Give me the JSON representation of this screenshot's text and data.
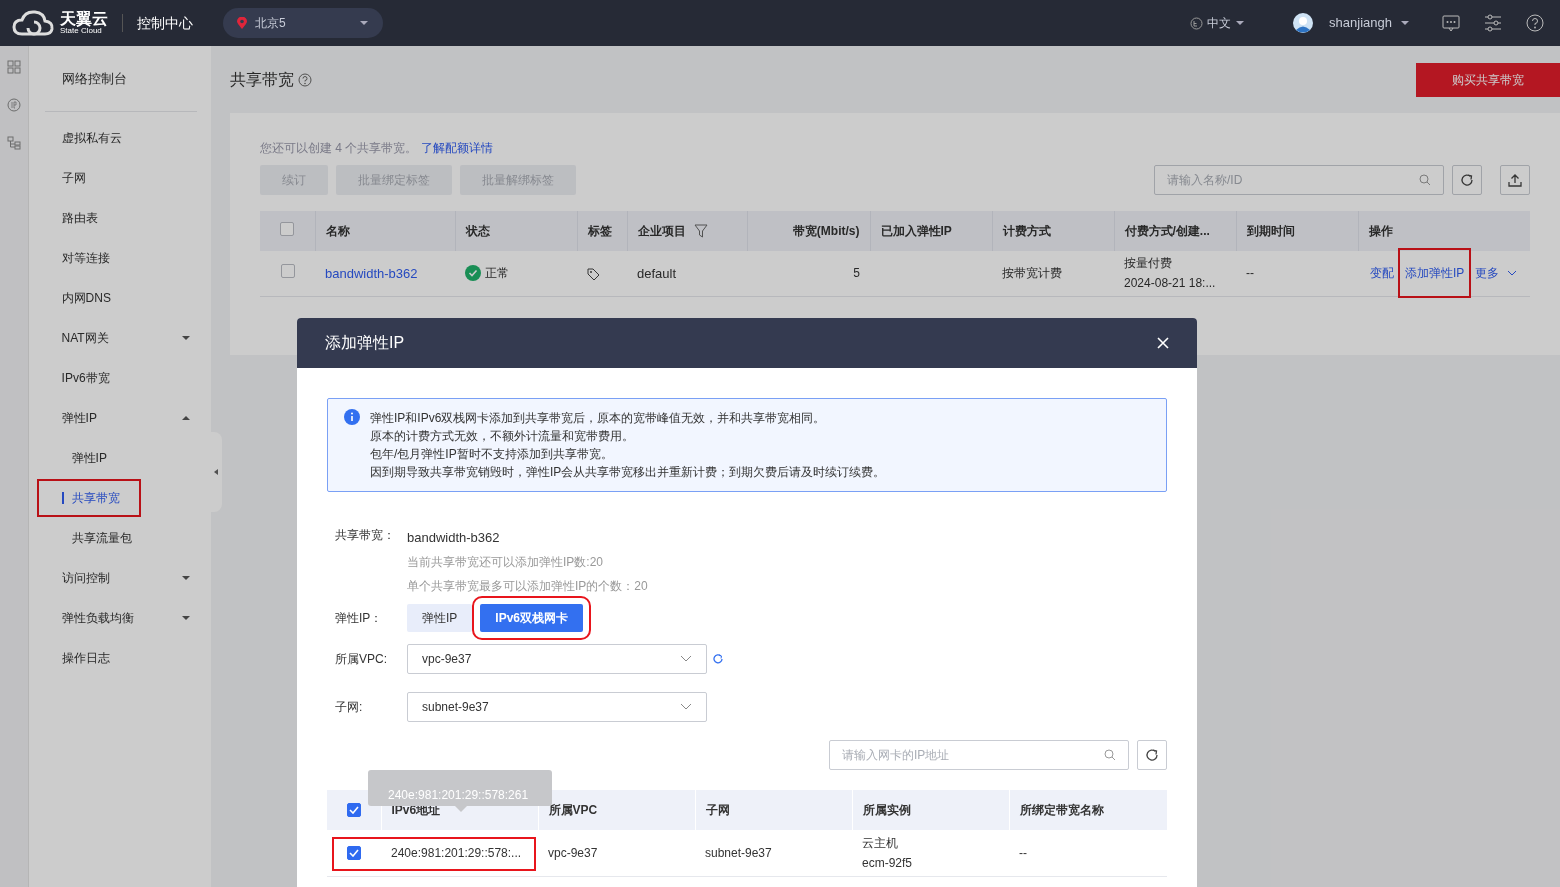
{
  "topbar": {
    "brand": "天翼云",
    "brand_sub": "State Cloud",
    "console": "控制中心",
    "region": "北京5",
    "language": "中文",
    "user": "shanjiangh"
  },
  "sidebar": {
    "title": "网络控制台",
    "items": [
      {
        "label": "虚拟私有云"
      },
      {
        "label": "子网"
      },
      {
        "label": "路由表"
      },
      {
        "label": "对等连接"
      },
      {
        "label": "内网DNS"
      },
      {
        "label": "NAT网关",
        "expanded": false
      },
      {
        "label": "IPv6带宽"
      },
      {
        "label": "弹性IP",
        "expanded": true,
        "children": [
          {
            "label": "弹性IP",
            "selected": false,
            "highlighted": false
          },
          {
            "label": "共享带宽",
            "selected": true,
            "highlighted": true
          },
          {
            "label": "共享流量包",
            "selected": false,
            "highlighted": false
          }
        ]
      },
      {
        "label": "访问控制",
        "expanded": false
      },
      {
        "label": "弹性负载均衡",
        "expanded": false
      },
      {
        "label": "操作日志"
      }
    ]
  },
  "page": {
    "title": "共享带宽",
    "buy_button": "购买共享带宽",
    "quota_text": "您还可以创建 4 个共享带宽。",
    "quota_link": "了解配额详情",
    "actions": [
      {
        "label": "续订",
        "disabled": true
      },
      {
        "label": "批量绑定标签",
        "disabled": true
      },
      {
        "label": "批量解绑标签",
        "disabled": true
      }
    ],
    "search": {
      "placeholder": "请输入名称/ID"
    },
    "table": {
      "all_checked": false,
      "columns": [
        "名称",
        "状态",
        "标签",
        "企业项目",
        "带宽(Mbit/s)",
        "已加入弹性IP",
        "计费方式",
        "付费方式/创建...",
        "到期时间",
        "操作"
      ],
      "rows": [
        {
          "checked": false,
          "name": "bandwidth-b362",
          "status": "正常",
          "project": "default",
          "bandwidth": "5",
          "billing": "按带宽计费",
          "payment": "按量付费",
          "created": "2024-08-21 18:...",
          "expiry": "--",
          "actions": [
            {
              "label": "变配",
              "highlighted": false
            },
            {
              "label": "添加弹性IP",
              "highlighted": true
            },
            {
              "label": "更多",
              "highlighted": false
            }
          ]
        }
      ]
    }
  },
  "modal": {
    "title": "添加弹性IP",
    "notice": [
      "弹性IP和IPv6双栈网卡添加到共享带宽后，原本的宽带峰值无效，并和共享带宽相同。",
      "原本的计费方式无效，不额外计流量和宽带费用。",
      "包年/包月弹性IP暂时不支持添加到共享带宽。",
      "因到期导致共享带宽销毁时，弹性IP会从共享带宽移出并重新计费；到期欠费后请及时续订续费。"
    ],
    "bandwidth_label": "共享带宽：",
    "bandwidth_value": "bandwidth-b362",
    "hints": [
      "当前共享带宽还可以添加弹性IP数:20",
      "单个共享带宽最多可以添加弹性IP的个数：20"
    ],
    "type_label": "弹性IP：",
    "types": [
      {
        "label": "弹性IP",
        "selected": false,
        "highlighted": false
      },
      {
        "label": "IPv6双栈网卡",
        "selected": true,
        "highlighted": true
      }
    ],
    "vpc_label": "所属VPC:",
    "vpc_value": "vpc-9e37",
    "subnet_label": "子网:",
    "subnet_value": "subnet-9e37",
    "search": {
      "placeholder": "请输入网卡的IP地址"
    },
    "table": {
      "all_checked": true,
      "columns": [
        "IPv6地址",
        "所属VPC",
        "子网",
        "所属实例",
        "所绑定带宽名称"
      ],
      "rows": [
        {
          "checked": true,
          "highlighted": true,
          "address": "240e:981:201:29::578:...",
          "vpc": "vpc-9e37",
          "subnet": "subnet-9e37",
          "instance_type": "云主机",
          "instance": "ecm-92f5",
          "bound": "--"
        }
      ]
    },
    "tooltip": "240e:981:201:29::578:261"
  }
}
